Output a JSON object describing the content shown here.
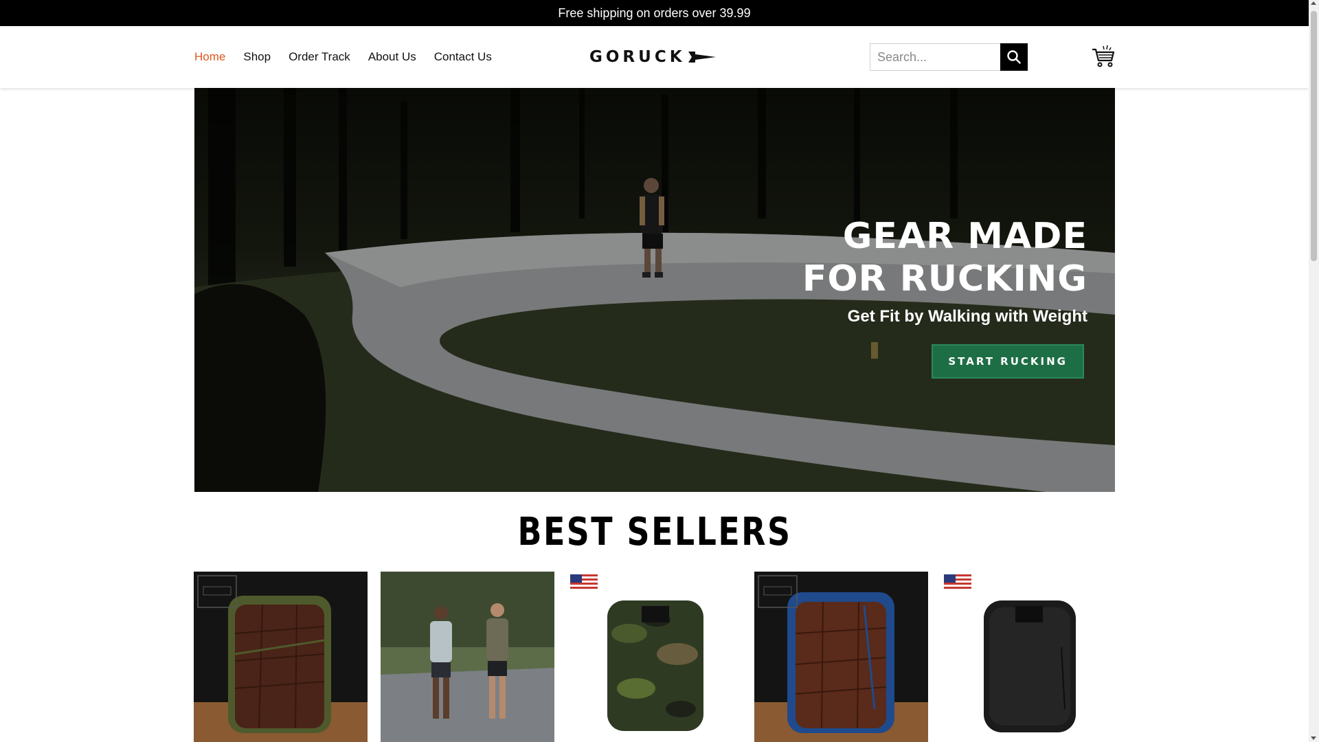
{
  "announcement": {
    "text": "Free shipping on orders over 39.99"
  },
  "nav": {
    "items": [
      {
        "label": "Home",
        "active": true
      },
      {
        "label": "Shop",
        "active": false
      },
      {
        "label": "Order Track",
        "active": false
      },
      {
        "label": "About Us",
        "active": false
      },
      {
        "label": "Contact Us",
        "active": false
      }
    ]
  },
  "logo": {
    "text": "GORUCK"
  },
  "search": {
    "placeholder": "Search..."
  },
  "hero": {
    "title": "GEAR MADE\nFOR RUCKING",
    "subtitle": "Get Fit by Walking with Weight",
    "cta_label": "START RUCKING"
  },
  "best_sellers": {
    "title": "BEST SELLERS",
    "products": [
      {
        "image": "brown-croc-leather-backpack-olive-trim",
        "badge": "built-by-soars-stamp"
      },
      {
        "image": "two-men-rucking-on-road",
        "badge": ""
      },
      {
        "image": "woodland-camo-backpack",
        "badge": "us-flag"
      },
      {
        "image": "brown-croc-leather-backpack-blue-trim",
        "badge": "built-by-soars-stamp"
      },
      {
        "image": "black-backpack",
        "badge": "us-flag"
      }
    ]
  },
  "colors": {
    "accent": "#e0571f",
    "cta_green": "#1e6e45",
    "bar": "#000000"
  }
}
